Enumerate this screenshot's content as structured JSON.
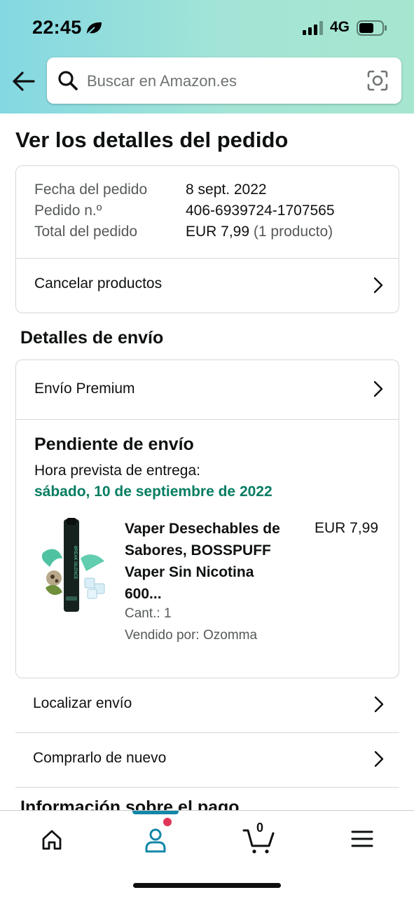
{
  "status_bar": {
    "time": "22:45",
    "network": "4G"
  },
  "header": {
    "search_placeholder": "Buscar en Amazon.es"
  },
  "page_title": "Ver los detalles del pedido",
  "order_summary": {
    "rows": [
      {
        "label": "Fecha del pedido",
        "value": "8 sept. 2022"
      },
      {
        "label": "Pedido n.º",
        "value": "406-6939724-1707565"
      },
      {
        "label": "Total del pedido",
        "value": "EUR 7,99",
        "extra": "(1 producto)"
      }
    ],
    "cancel_label": "Cancelar productos"
  },
  "shipping": {
    "section_title": "Detalles de envío",
    "method": "Envío Premium",
    "status": "Pendiente de envío",
    "eta_label": "Hora prevista de entrega:",
    "eta_date": "sábado, 10 de septiembre de 2022",
    "product": {
      "name": "Vaper Desechables de Sabores, BOSSPUFF Vaper Sin Nicotina 600...",
      "price": "EUR 7,99",
      "quantity": "Cant.: 1",
      "seller": "Vendido por: Ozomma",
      "device_text": "BREAK SILENCE"
    }
  },
  "actions": [
    {
      "label": "Localizar envío"
    },
    {
      "label": "Comprarlo de nuevo"
    }
  ],
  "next_section_peek": "Información sobre el pago",
  "tabbar": {
    "items": [
      "home-icon",
      "account-icon",
      "cart-icon",
      "menu-icon"
    ],
    "cart_count": "0",
    "active_index": 1,
    "accent": "#1287a8",
    "badge_color": "#e0365a"
  },
  "colors": {
    "header_gradient_start": "#84d8e2",
    "header_gradient_end": "#a6e6cf",
    "eta_green": "#067d62"
  }
}
